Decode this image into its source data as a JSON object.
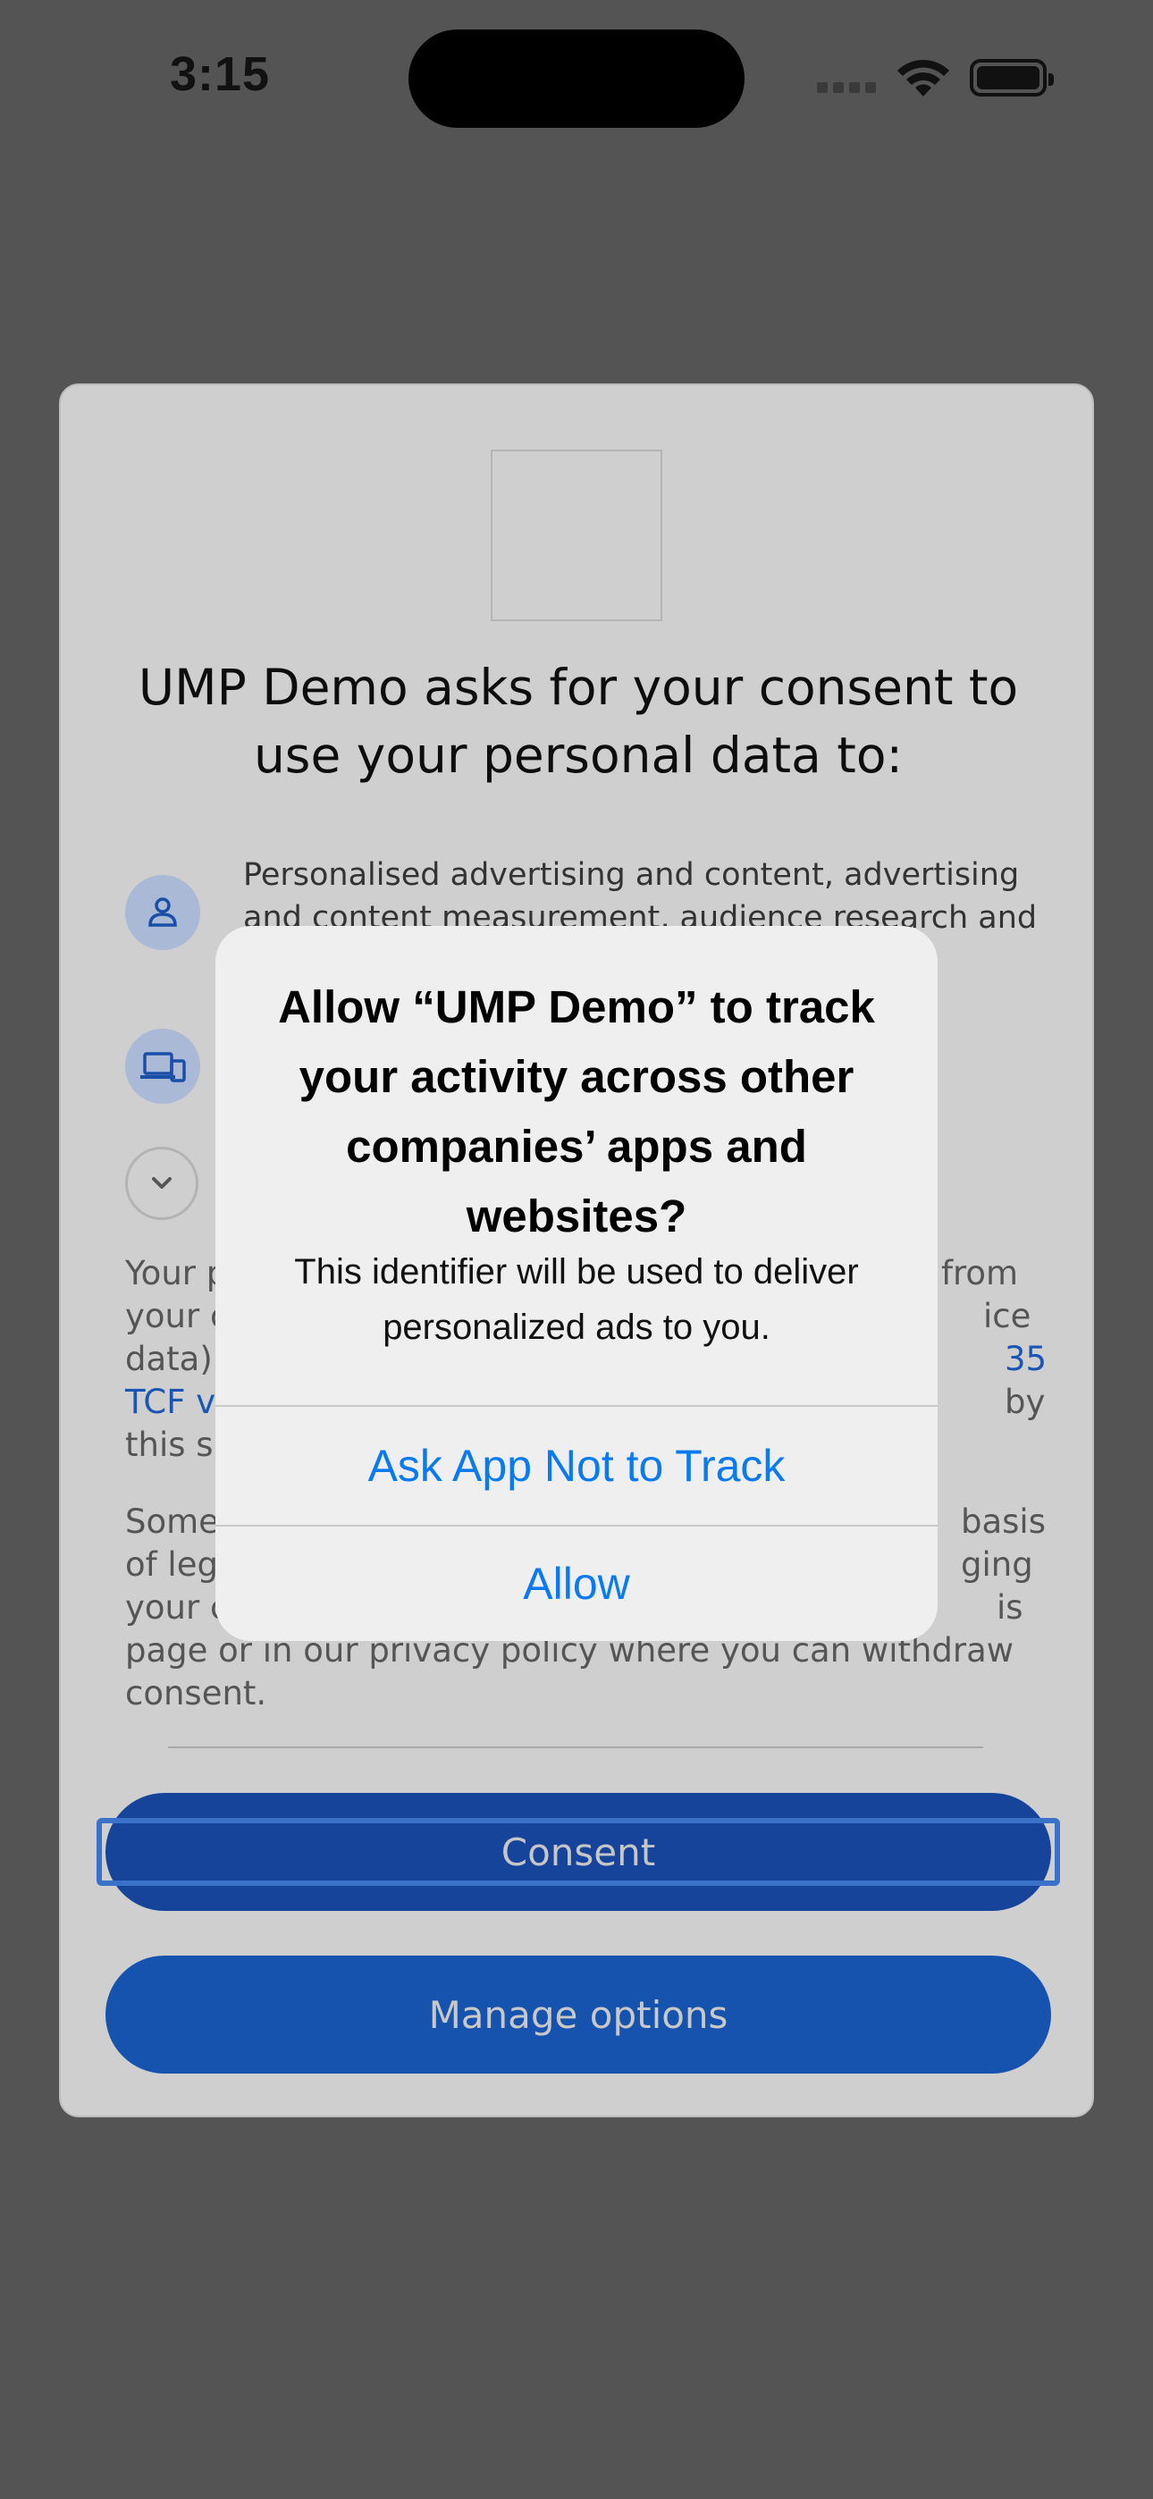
{
  "status_bar": {
    "time": "3:15"
  },
  "consent_card": {
    "title": "UMP Demo asks for your consent to use your personal data to:",
    "purposes": [
      {
        "icon": "person-icon",
        "text": "Personalised advertising and content, advertising and content measurement, audience research and"
      },
      {
        "icon": "devices-icon",
        "text": ""
      }
    ],
    "expand_icon": "chevron-down-icon",
    "paragraph_1": {
      "text_start": "Your p",
      "text_right": "from",
      "line2_start": "your c",
      "line2_right": "ice",
      "line3_start": "data) r",
      "line3_right": "35",
      "line4_link": "TCF ve",
      "line4_right": "by",
      "line5_start": "this sit"
    },
    "paragraph_2": {
      "line1_start": "Some",
      "line1_right": "basis",
      "line2_start": "of legi",
      "line2_right": "ging",
      "line3_start": "your c",
      "line3_right": "is",
      "line4": "page or in our privacy policy where you can withdraw",
      "line5": "consent."
    },
    "consent_button": "Consent",
    "manage_button": "Manage options"
  },
  "tracking_alert": {
    "title": "Allow “UMP Demo” to track your activity across other companies’ apps and websites?",
    "message": "This identifier will be used to deliver personalized ads to you.",
    "ask_not_to_track": "Ask App Not to Track",
    "allow": "Allow"
  },
  "colors": {
    "overlay": "#545454",
    "card": "#cfcfcf",
    "primary_button": "#16449a",
    "alert_action": "#0a7af0"
  }
}
